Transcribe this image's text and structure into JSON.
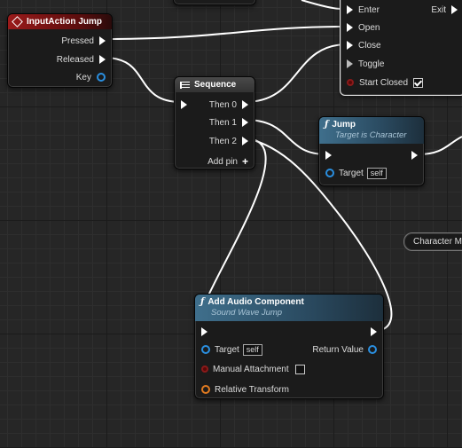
{
  "input_action": {
    "title": "InputAction Jump",
    "pins": {
      "pressed": "Pressed",
      "released": "Released",
      "key": "Key"
    }
  },
  "flipflop": {
    "pins": {
      "enter": "Enter",
      "open": "Open",
      "close": "Close",
      "toggle": "Toggle",
      "exit": "Exit",
      "start_closed": "Start Closed"
    },
    "start_closed_checked": true
  },
  "sequence": {
    "title": "Sequence",
    "pins": {
      "then0": "Then 0",
      "then1": "Then 1",
      "then2": "Then 2",
      "add_pin": "Add pin"
    }
  },
  "jump": {
    "title": "Jump",
    "subtitle": "Target is Character",
    "target_label": "Target",
    "target_value": "self"
  },
  "character_movement": {
    "label": "Character Mov"
  },
  "add_audio": {
    "title": "Add Audio Component",
    "subtitle": "Sound Wave Jump",
    "target_label": "Target",
    "target_value": "self",
    "return_value": "Return Value",
    "manual_attachment": "Manual Attachment",
    "relative_transform": "Relative Transform"
  },
  "colors": {
    "exec_wire": "#ffffff",
    "event_header": "#9a1a1a",
    "function_header": "#3f6f8c",
    "object_pin": "#2a8fe0"
  }
}
